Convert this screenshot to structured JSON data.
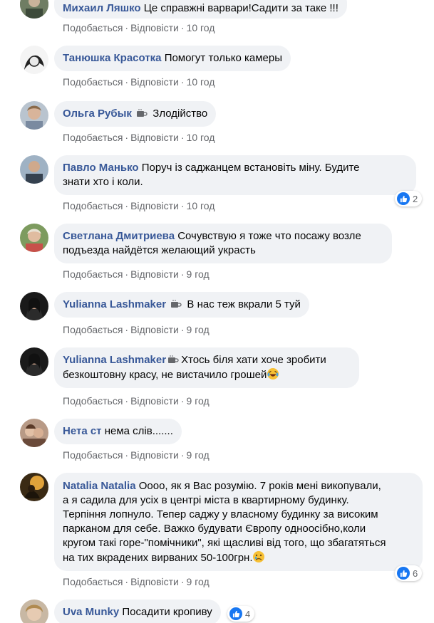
{
  "actions": {
    "like": "Подобається",
    "reply": "Відповісти",
    "sep": "·"
  },
  "comments": [
    {
      "author": "Михаил Ляшко",
      "text": "Це справжні варвари!Садити за таке !!!",
      "time": "10 год"
    },
    {
      "author": "Танюшка Красотка",
      "text": "Помогут только камеры",
      "time": "10 год"
    },
    {
      "author": "Ольга Рубык",
      "badge": "coffee-icon",
      "text": "Злодійство",
      "time": "10 год"
    },
    {
      "author": "Павло Манько",
      "line1": "Поруч із саджанцем встановіть міну. Будите",
      "line2": "знати хто і коли.",
      "time": "10 год",
      "reactions": "2"
    },
    {
      "author": "Светлана Дмитриева",
      "line1": "Сочувствую я тоже что посажу возле",
      "line2": "подъезда найдётся желающий украсть",
      "time": "9 год"
    },
    {
      "author": "Yulianna Lashmaker",
      "badge": "coffee-icon",
      "text": "В нас теж вкрали 5 туй",
      "time": "9 год"
    },
    {
      "author": "Yulianna Lashmaker",
      "badge": "coffee-icon",
      "line1": "Хтось біля хати хоче зробити",
      "line2": "безкоштовну красу, не вистачило грошей",
      "emoji": "laughing-tears-emoji",
      "time": "9 год"
    },
    {
      "author": "Нета ст",
      "text": "нема слів.......",
      "time": "9 год"
    },
    {
      "author": "Natalia Natalia",
      "line1": "Оооо, як я Вас розумію. 7 років мені викопували,",
      "line2": "а я садила для усіх в центрі міста в квартирному будинку.",
      "line3": "Терпіння лопнуло. Тепер саджу у власному будинку за високим",
      "line4": "парканом для себе. Важко будувати Європу одноосібно,коли",
      "line5": "кругом такі горе-\"помічники\", які щасливі від того, що збагатяться",
      "line6": "на тих вкрадених вирваних 50-100грн.",
      "emoji": "sad-emoji",
      "time": "9 год",
      "reactions": "6"
    },
    {
      "author": "Uva Munky",
      "text": "Посадити кропиву",
      "reactions": "4"
    }
  ],
  "colors": {
    "author": "#385898",
    "bubble": "#f0f2f5",
    "meta": "#65676b",
    "like": "#1877f2"
  }
}
